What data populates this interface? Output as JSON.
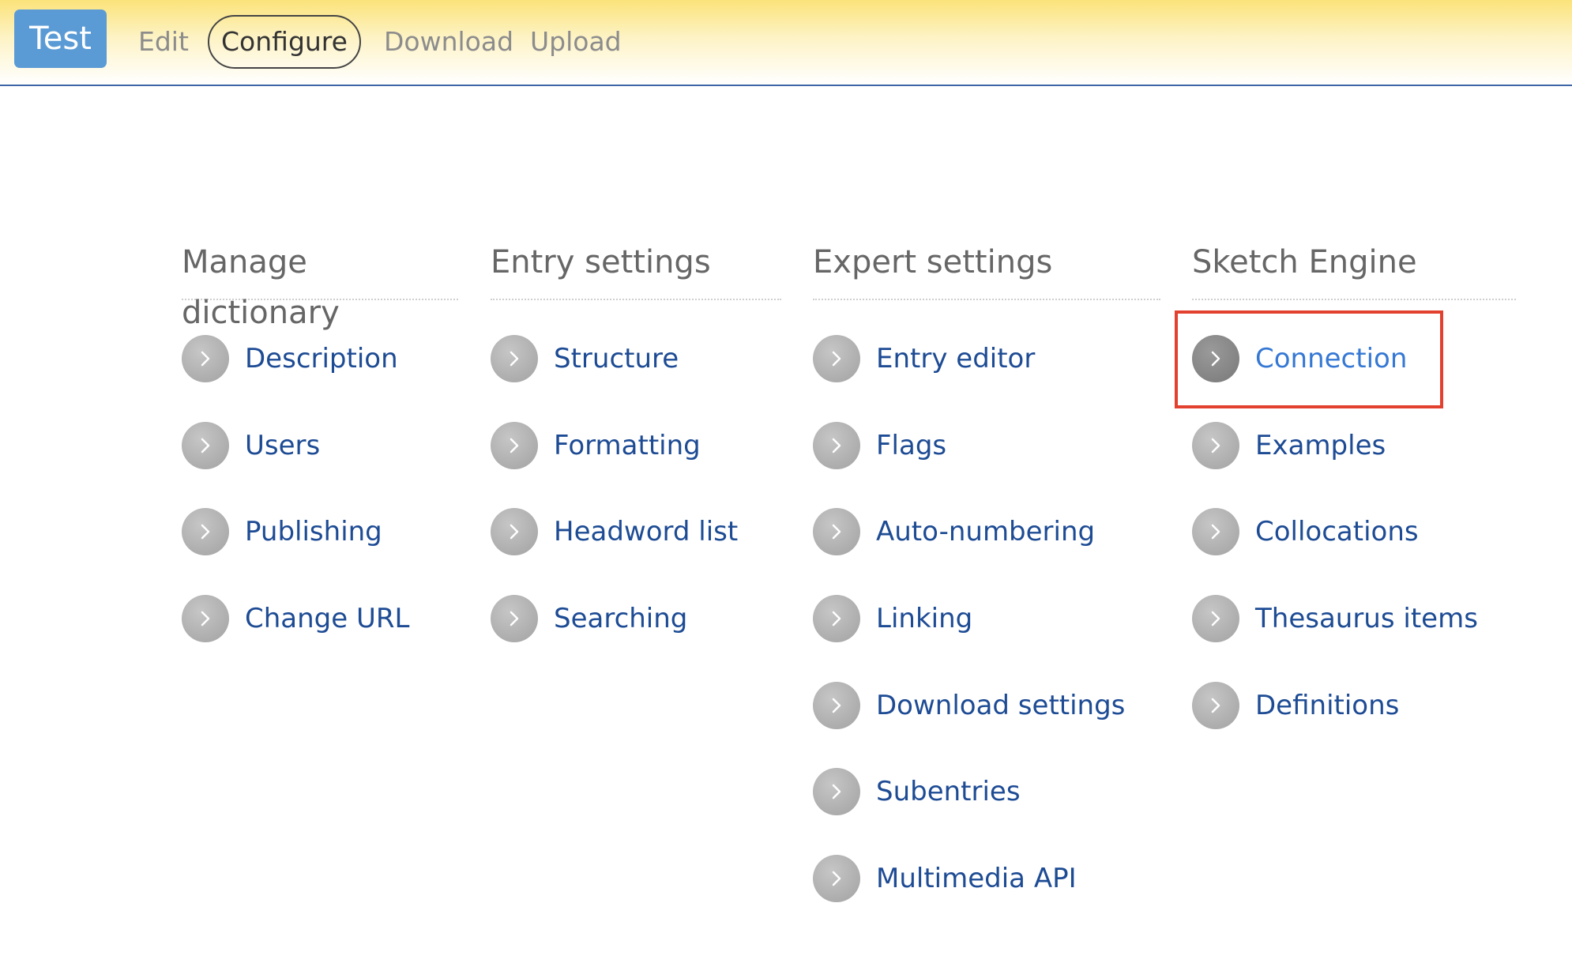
{
  "header": {
    "dictionary_title": "Test",
    "nav": [
      {
        "label": "Edit",
        "active": false
      },
      {
        "label": "Configure",
        "active": true
      },
      {
        "label": "Download",
        "active": false
      },
      {
        "label": "Upload",
        "active": false
      }
    ]
  },
  "columns": [
    {
      "heading": "Manage dictionary",
      "items": [
        "Description",
        "Users",
        "Publishing",
        "Change URL"
      ]
    },
    {
      "heading": "Entry settings",
      "items": [
        "Structure",
        "Formatting",
        "Headword list",
        "Searching"
      ]
    },
    {
      "heading": "Expert settings",
      "items": [
        "Entry editor",
        "Flags",
        "Auto-numbering",
        "Linking",
        "Download settings",
        "Subentries",
        "Multimedia API"
      ]
    },
    {
      "heading": "Sketch Engine",
      "items": [
        "Connection",
        "Examples",
        "Collocations",
        "Thesaurus items",
        "Definitions"
      ]
    }
  ],
  "icons": {
    "menu_item_icon": "chevron-right-circle-icon"
  },
  "highlight": {
    "item": "Connection",
    "color": "#e3412f"
  },
  "colors": {
    "link": "#1d4b94",
    "header_accent": "#5b9bd5",
    "header_border": "#3e66a6"
  }
}
